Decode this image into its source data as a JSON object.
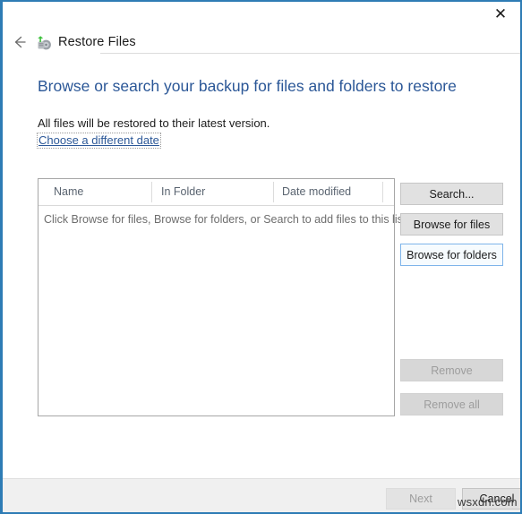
{
  "window": {
    "title": "Restore Files",
    "app_icon": "restore-drive-icon",
    "close_label": "✕",
    "back_label": "back-arrow",
    "accent_color": "#2e7cb5"
  },
  "content": {
    "heading": "Browse or search your backup for files and folders to restore",
    "subtext": "All files will be restored to their latest version.",
    "date_link": "Choose a different date",
    "heading_color": "#2b5797"
  },
  "file_list": {
    "columns": [
      "Name",
      "In Folder",
      "Date modified"
    ],
    "rows": [],
    "empty_message": "Click Browse for files, Browse for folders, or Search to add files to this list."
  },
  "side_buttons": [
    {
      "label": "Search...",
      "state": "normal",
      "name": "search-button"
    },
    {
      "label": "Browse for files",
      "state": "normal",
      "name": "browse-for-files-button"
    },
    {
      "label": "Browse for folders",
      "state": "hover",
      "name": "browse-for-folders-button"
    },
    {
      "label": "Remove",
      "state": "disabled",
      "name": "remove-button"
    },
    {
      "label": "Remove all",
      "state": "disabled",
      "name": "remove-all-button"
    }
  ],
  "footer": {
    "next_label": "Next",
    "next_state": "disabled",
    "cancel_label": "Cancel",
    "cancel_state": "normal"
  },
  "watermark": {
    "text": "wsxdn.com"
  }
}
